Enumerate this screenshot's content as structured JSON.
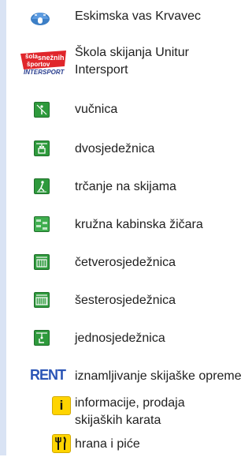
{
  "legend": {
    "items": [
      {
        "icon": "igloo-icon",
        "label": "Eskimska vas Krvavec"
      },
      {
        "icon": "ski-school-logo",
        "label_line1": "Škola skijanja Unitur",
        "label_line2": "Intersport",
        "logo_text_1": "šola",
        "logo_text_2": "snežnih",
        "logo_text_3": "športov",
        "logo_text_4": "INTERSPORT"
      },
      {
        "icon": "drag-lift-icon",
        "label": "vučnica"
      },
      {
        "icon": "double-chairlift-icon",
        "label": "dvosjedežnica"
      },
      {
        "icon": "cross-country-skiing-icon",
        "label": "trčanje na skijama"
      },
      {
        "icon": "gondola-icon",
        "label": "kružna kabinska žičara"
      },
      {
        "icon": "quad-chairlift-icon",
        "label": "četverosjedežnica"
      },
      {
        "icon": "six-chairlift-icon",
        "label": "šesterosjedežnica"
      },
      {
        "icon": "single-chairlift-icon",
        "label": "jednosjedežnica"
      },
      {
        "icon": "rent-icon",
        "icon_text": "RENT",
        "label": "iznamljivanje skijaške opreme"
      },
      {
        "icon": "info-icon",
        "icon_text": "i",
        "label_line1": "informacije, prodaja",
        "label_line2": "skijaških karata"
      },
      {
        "icon": "food-drink-icon",
        "label": "hrana i piće"
      }
    ]
  },
  "colors": {
    "green": "#2e9a3c",
    "yellow": "#ffd400",
    "rent_blue": "#2a54b6",
    "logo_red": "#e0262b",
    "strip": "#d9e3f4"
  }
}
